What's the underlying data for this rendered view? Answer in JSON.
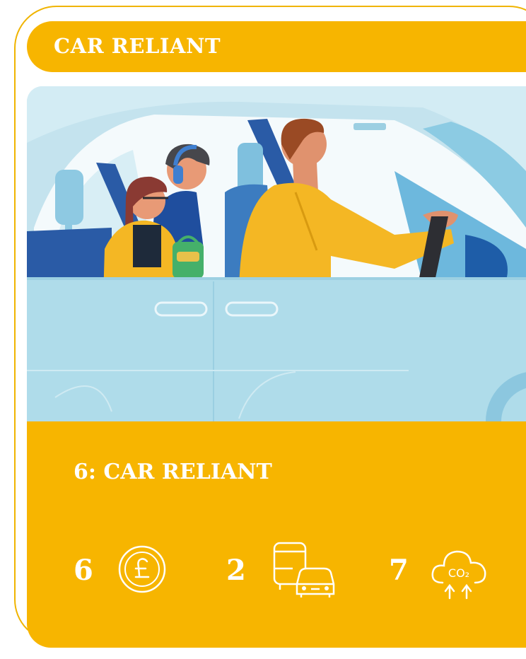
{
  "header": {
    "title": "CAR RELIANT"
  },
  "scenario": {
    "title": "6: CAR RELIANT"
  },
  "metrics": [
    {
      "value": "6",
      "icon": "pound-coin-icon"
    },
    {
      "value": "2",
      "icon": "bus-and-car-icon"
    },
    {
      "value": "7",
      "icon": "co2-cloud-icon"
    }
  ],
  "co2_label": "CO₂",
  "colors": {
    "accent": "#F7B500",
    "sky": "#BFE2EE",
    "car_body": "#AFDCEA",
    "text": "#FFFFFF"
  }
}
